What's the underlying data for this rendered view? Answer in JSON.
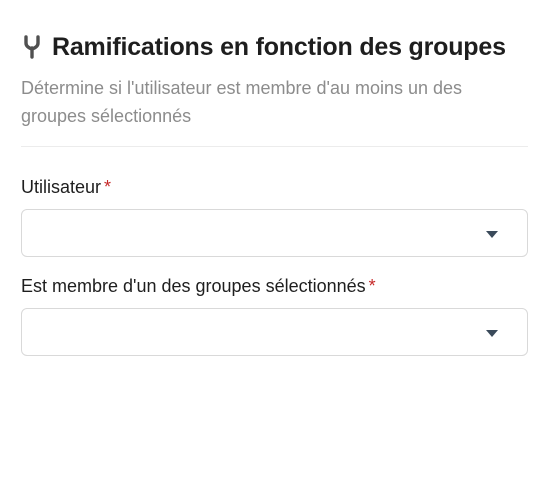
{
  "header": {
    "icon": "branch-merge-icon",
    "title": "Ramifications en fonction des groupes",
    "description": "Détermine si l'utilisateur est membre d'au moins un des groupes sélectionnés"
  },
  "fields": [
    {
      "label": "Utilisateur",
      "required_mark": "*",
      "value": ""
    },
    {
      "label": "Est membre d'un des groupes sélectionnés",
      "required_mark": "*",
      "value": ""
    }
  ],
  "colors": {
    "required": "#c62828",
    "description": "#8c8c8c",
    "border": "#d9d9d9",
    "caret": "#3a4a5a"
  }
}
